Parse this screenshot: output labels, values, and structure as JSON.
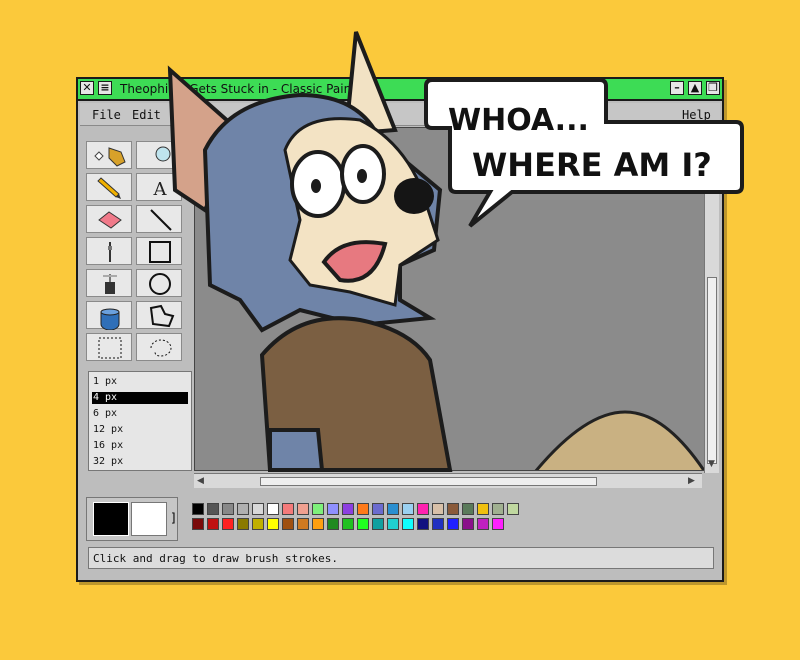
{
  "window": {
    "title": "Theophilus Gets Stuck in - Classic Paint"
  },
  "menu": {
    "file": "File",
    "edit": "Edit",
    "help": "Help"
  },
  "tools": [
    {
      "name": "free-select-icon"
    },
    {
      "name": "magnifier-icon"
    },
    {
      "name": "pencil-icon"
    },
    {
      "name": "text-icon",
      "glyph": "A"
    },
    {
      "name": "eraser-icon"
    },
    {
      "name": "line-icon"
    },
    {
      "name": "brush-icon"
    },
    {
      "name": "rectangle-icon"
    },
    {
      "name": "airbrush-icon"
    },
    {
      "name": "ellipse-icon"
    },
    {
      "name": "fill-bucket-icon"
    },
    {
      "name": "polygon-icon"
    },
    {
      "name": "rect-select-icon"
    },
    {
      "name": "lasso-icon"
    }
  ],
  "brush_sizes": [
    "1 px",
    "4 px",
    "6 px",
    "12 px",
    "16 px",
    "32 px"
  ],
  "selected_size": "4 px",
  "color_bracket": "]",
  "palette_row1": [
    "#000000",
    "#555555",
    "#888888",
    "#b0b0b0",
    "#d8d8d8",
    "#ffffff",
    "#f47a7a",
    "#f0a090",
    "#7ef07a",
    "#8f90ff",
    "#8c3fe0",
    "#ff7a1a",
    "#6b6bcf",
    "#2b8fd0",
    "#9ad0f0",
    "#ff22b0",
    "#d8c0a8",
    "#8a5a3a",
    "#5a7a5a",
    "#f0c010",
    "#a0b090",
    "#c0d8a0"
  ],
  "palette_row2": [
    "#7a0a0a",
    "#c01010",
    "#ff2020",
    "#8a7a00",
    "#c0b000",
    "#ffff00",
    "#a05010",
    "#d07a20",
    "#ffa010",
    "#208a20",
    "#20c020",
    "#20ff20",
    "#10a0a0",
    "#20d0d0",
    "#10ffff",
    "#101080",
    "#2030c0",
    "#2020ff",
    "#8a108a",
    "#c020c0",
    "#ff20ff"
  ],
  "status": "Click and drag to draw brush strokes.",
  "speech": {
    "line1": "WHOA...",
    "line2": "WHERE AM I?"
  }
}
